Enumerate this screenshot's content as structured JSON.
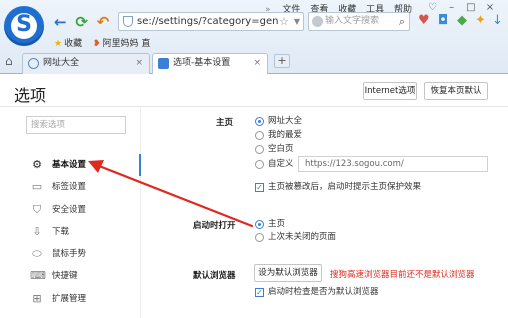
{
  "browser": {
    "menu": [
      "文件",
      "查看",
      "收藏",
      "工具",
      "帮助"
    ],
    "url": "se://settings/?category=gen",
    "search_placeholder": "输入文字搜索",
    "bookmarks": [
      "收藏",
      "阿里妈妈 直"
    ],
    "tabs": [
      {
        "label": "网址大全",
        "active": false
      },
      {
        "label": "选项-基本设置",
        "active": true
      }
    ],
    "accent": "#3b7fd6"
  },
  "page": {
    "title": "选项",
    "ie_options_button": "Internet选项",
    "restore_default_button": "恢复本页默认"
  },
  "sidebar": {
    "search_placeholder": "搜索选项",
    "items": [
      {
        "label": "基本设置",
        "icon": "gear-icon",
        "active": true
      },
      {
        "label": "标签设置",
        "icon": "tab-icon",
        "active": false
      },
      {
        "label": "安全设置",
        "icon": "shield-icon",
        "active": false
      },
      {
        "label": "下载",
        "icon": "download-icon",
        "active": false
      },
      {
        "label": "鼠标手势",
        "icon": "mouse-icon",
        "active": false
      },
      {
        "label": "快捷键",
        "icon": "keyboard-icon",
        "active": false
      },
      {
        "label": "扩展管理",
        "icon": "extensions-icon",
        "active": false
      }
    ]
  },
  "homepage": {
    "label": "主页",
    "options": [
      {
        "label": "网址大全",
        "selected": true
      },
      {
        "label": "我的最爱",
        "selected": false
      },
      {
        "label": "空白页",
        "selected": false
      },
      {
        "label": "自定义",
        "selected": false
      }
    ],
    "custom_url_placeholder": "https://123.sogou.com/",
    "protect_check_label": "主页被篡改后，启动时提示主页保护效果",
    "protect_checked": true
  },
  "startup": {
    "label": "启动时打开",
    "options": [
      {
        "label": "主页",
        "selected": true
      },
      {
        "label": "上次未关闭的页面",
        "selected": false
      }
    ]
  },
  "default_browser": {
    "label": "默认浏览器",
    "button": "设为默认浏览器",
    "warning": "搜狗高速浏览器目前还不是默认浏览器",
    "check_label": "启动时检查是否为默认浏览器",
    "checked": true,
    "warning_color": "#e0281e"
  },
  "annotation_color": "#e0281e"
}
